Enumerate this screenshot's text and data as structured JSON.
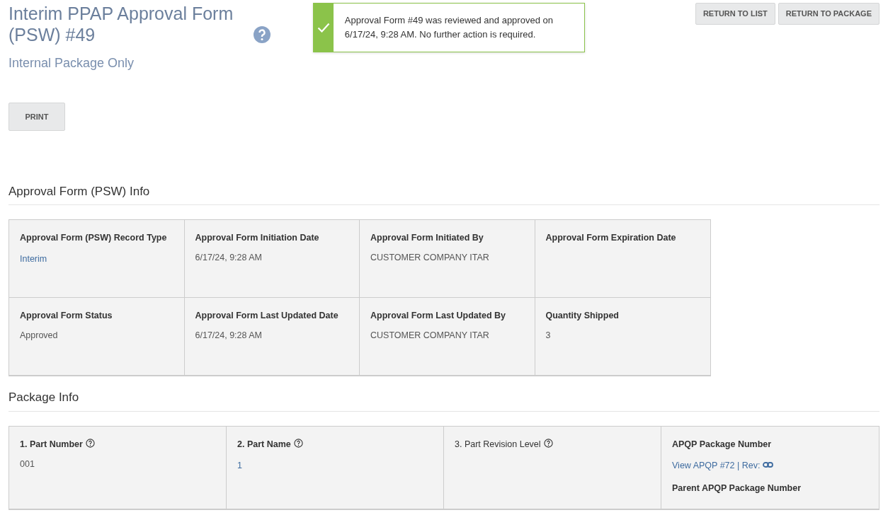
{
  "header": {
    "title": "Interim PPAP Approval Form (PSW) #49",
    "help_icon": true,
    "subtitle": "Internal Package Only"
  },
  "toast": {
    "kind": "success",
    "message": "Approval Form #49 was reviewed and approved on 6/17/24, 9:28 AM. No further action is required."
  },
  "top_buttons": [
    "RETURN TO LIST",
    "RETURN TO PACKAGE"
  ],
  "print_button": "PRINT",
  "sections": [
    {
      "title": "Approval Form (PSW) Info",
      "cells": [
        {
          "lines": [
            {
              "kind": "label",
              "text": "Approval Form (PSW) Record Type"
            },
            {
              "kind": "link",
              "text": "Interim"
            }
          ]
        },
        {
          "lines": [
            {
              "kind": "label",
              "text": "Approval Form Initiation Date"
            },
            {
              "kind": "value",
              "text": "6/17/24, 9:28 AM"
            }
          ]
        },
        {
          "lines": [
            {
              "kind": "label",
              "text": "Approval Form Initiated By"
            },
            {
              "kind": "value",
              "text": "CUSTOMER COMPANY ITAR"
            }
          ]
        },
        {
          "lines": [
            {
              "kind": "label",
              "text": "Approval Form Expiration Date"
            }
          ]
        },
        {
          "lines": [
            {
              "kind": "label",
              "text": "Approval Form Status"
            },
            {
              "kind": "value",
              "text": "Approved"
            }
          ]
        },
        {
          "lines": [
            {
              "kind": "label",
              "text": "Approval Form Last Updated Date"
            },
            {
              "kind": "value",
              "text": "6/17/24, 9:28 AM"
            }
          ]
        },
        {
          "lines": [
            {
              "kind": "label",
              "text": "Approval Form Last Updated By"
            },
            {
              "kind": "value",
              "text": "CUSTOMER COMPANY ITAR"
            }
          ]
        },
        {
          "lines": [
            {
              "kind": "label",
              "text": "Quantity Shipped"
            },
            {
              "kind": "value",
              "text": "3"
            }
          ]
        }
      ]
    },
    {
      "title": "Package Info",
      "cells": [
        {
          "lines": [
            {
              "kind": "label",
              "text": "1. Part Number",
              "help": true
            },
            {
              "kind": "value",
              "text": "001"
            }
          ]
        },
        {
          "lines": [
            {
              "kind": "label",
              "text": "2. Part Name",
              "help": true
            },
            {
              "kind": "link",
              "text": "1"
            }
          ]
        },
        {
          "lines": [
            {
              "kind": "label_light",
              "text": "3. Part Revision Level",
              "help": true
            }
          ]
        },
        {
          "lines": [
            {
              "kind": "label",
              "text": "APQP Package Number"
            },
            {
              "kind": "link",
              "text": "View APQP #72 | Rev:",
              "chain_icon": true
            },
            {
              "kind": "label",
              "text": "Parent APQP Package Number"
            }
          ]
        }
      ]
    }
  ]
}
